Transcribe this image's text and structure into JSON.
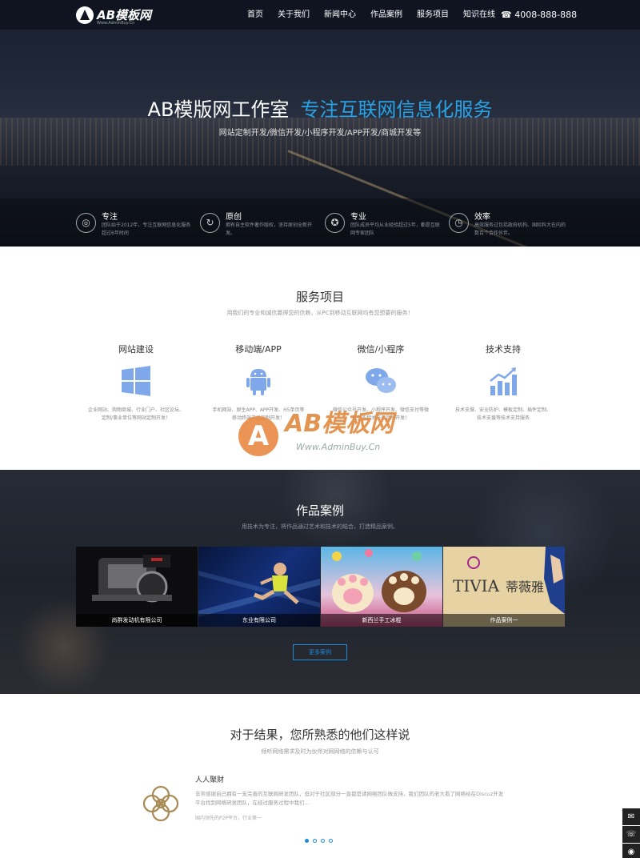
{
  "header": {
    "logo_text": "AB模板网",
    "logo_sub": "Www.AdminBuy.Cn",
    "nav": [
      "首页",
      "关于我们",
      "新闻中心",
      "作品案例",
      "服务项目",
      "知识在线"
    ],
    "phone": "☎ 4008-888-888"
  },
  "hero": {
    "title": "AB模版网工作室",
    "highlight": "专注互联网信息化服务",
    "tagline": "网站定制开发/微信开发/小程序开发/APP开发/商城开发等",
    "features": [
      {
        "title": "专注",
        "icon": "compass-icon",
        "desc": "团队始于2012年，专注互联网信息化服务超过6年时间"
      },
      {
        "title": "原创",
        "icon": "refresh-icon",
        "desc": "拥有自主软件著作版权，坚持原创全新开发。"
      },
      {
        "title": "专业",
        "icon": "badge-icon",
        "desc": "团队成员平均从业经验超过5年，都是互联网专家团队"
      },
      {
        "title": "效率",
        "icon": "clock-icon",
        "desc": "高效服务过包括政府机构、国际料大在内的数百个合作伙伴。"
      }
    ]
  },
  "services": {
    "title": "服务项目",
    "subtitle": "用我们的专业和诚信赢得您的信赖，从PC到移动互联网均有您想要的服务！",
    "items": [
      {
        "name": "网站建设",
        "desc": "企业网站、购物商城、行业门户、社区论坛、定制/事业单位等网站定制开发！"
      },
      {
        "name": "移动端/APP",
        "desc": "手机网站、原生APP、APP开发、H5单页等移动终端产品定制开发！"
      },
      {
        "name": "微信/小程序",
        "desc": "微信公众号开发、小程序开发、微信支付等微信生态相关产品定制开发！"
      },
      {
        "name": "技术支持",
        "desc": "技术支撑、安全防护、模板定制、插件定制、技术支援等技术支持服务"
      }
    ]
  },
  "watermark": {
    "letter": "A",
    "brand": "AB模板网",
    "url": "Www.AdminBuy.Cn"
  },
  "cases": {
    "title": "作品案例",
    "subtitle": "用技术为专注，将作品通过艺术和技术的结合，打造精品案例。",
    "items": [
      {
        "caption": "尚群发动机有限公司"
      },
      {
        "caption": "东业有限公司"
      },
      {
        "caption": "新西兰手工冰棍"
      },
      {
        "caption": "作品案例一"
      }
    ],
    "case4_brand": "TIVIA",
    "case4_cn": "蒂薇雅",
    "more": "更多案例"
  },
  "testimonials": {
    "title": "对于结果，您所熟悉的他们这样说",
    "subtitle": "倾听网络需求及时为伙伴对网网络的信赖与认可",
    "name": "人人聚财",
    "text": "非常感谢自己拥有一支完善的互联网研发团队，但对于社区部分一直都是请网络团队做支持，我们团队的老大看了网络给在Discuz开发平台找到网络研发团队，在经过服务过程中我们...",
    "footer": "国内领先的P2P平台，行业第一"
  },
  "sidebar": {
    "icons": [
      "chat-icon",
      "phone-icon",
      "wechat-icon"
    ]
  }
}
